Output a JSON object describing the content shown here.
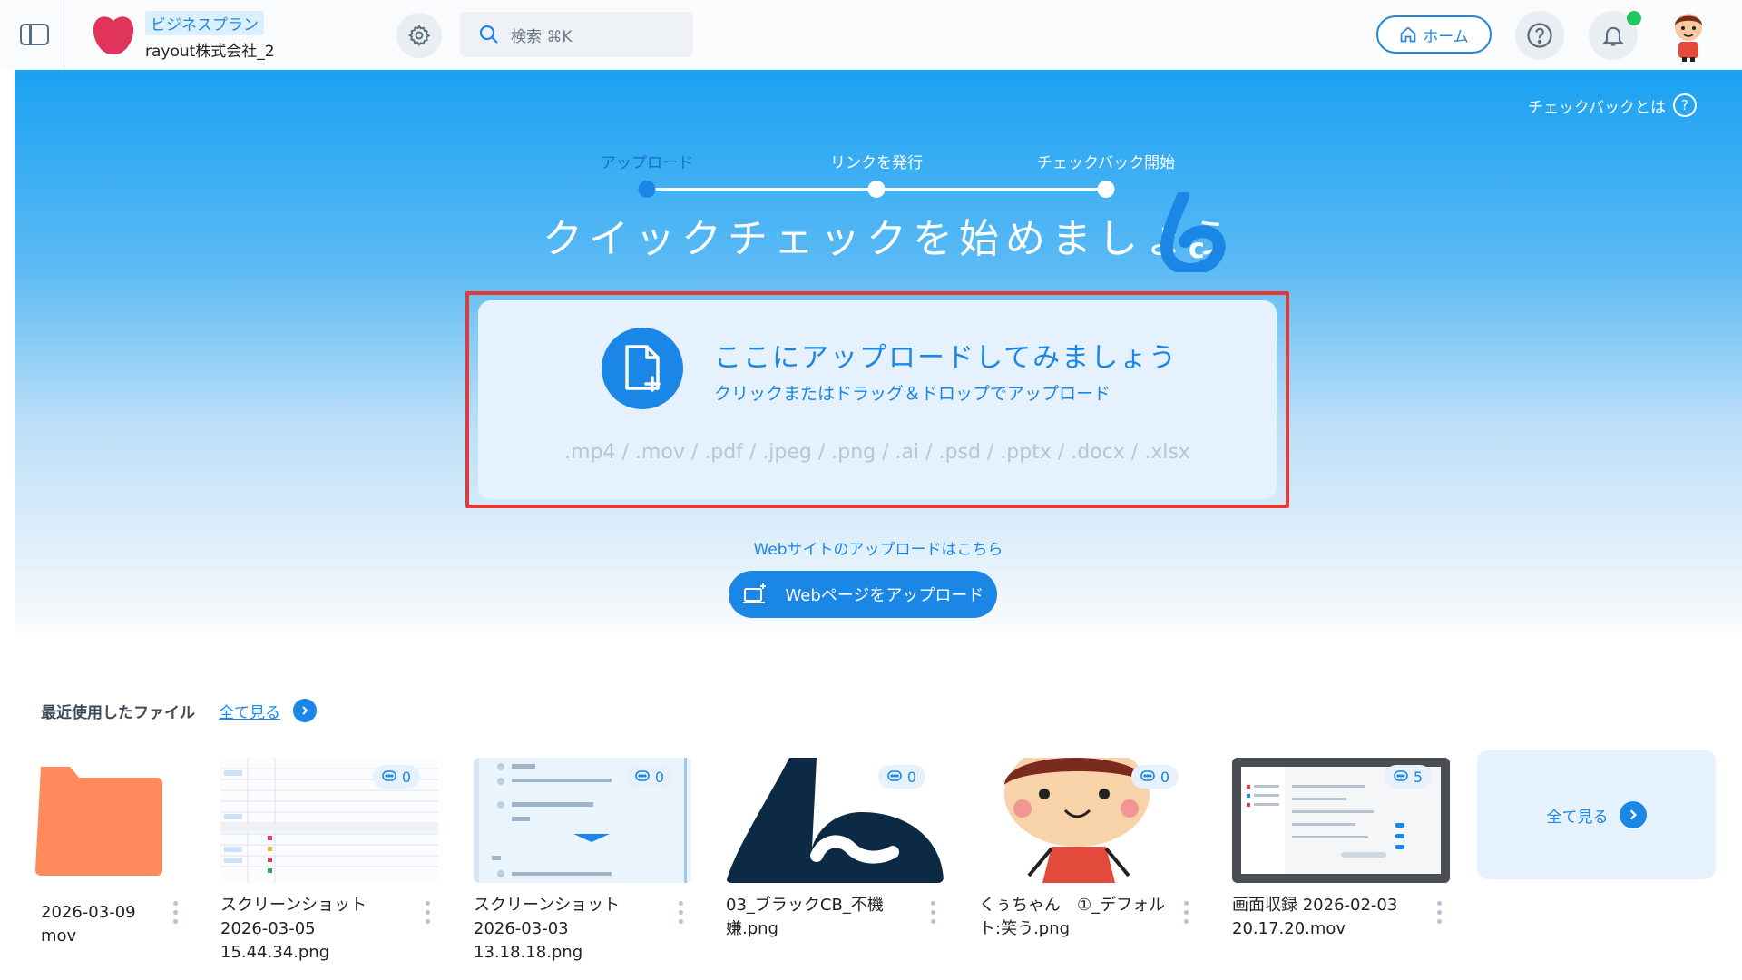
{
  "header": {
    "plan_badge": "ビジネスプラン",
    "org_name": "rayout株式会社_2",
    "search_placeholder": "検索 ⌘K",
    "home_label": "ホーム"
  },
  "hero": {
    "checkback_link": "チェックバックとは",
    "steps": [
      {
        "label": "アップロード",
        "active": true
      },
      {
        "label": "リンクを発行",
        "active": false
      },
      {
        "label": "チェックバック開始",
        "active": false
      }
    ],
    "title": "クイックチェックを始めましょう",
    "upload": {
      "title": "ここにアップロードしてみましょう",
      "subtitle": "クリックまたはドラッグ＆ドロップでアップロード",
      "formats": ".mp4 / .mov / .pdf / .jpeg / .png / .ai / .psd / .pptx / .docx / .xlsx"
    },
    "web_link": "Webサイトのアップロードはこちら",
    "web_button": "Webページをアップロード"
  },
  "recent": {
    "title": "最近使用したファイル",
    "see_all": "全て見る",
    "files": [
      {
        "name": "2026-03-09\nmov",
        "comments": null,
        "kind": "folder"
      },
      {
        "name": "スクリーンショット 2026-03-05 15.44.34.png",
        "comments": "0",
        "kind": "table"
      },
      {
        "name": "スクリーンショット 2026-03-03 13.18.18.png",
        "comments": "0",
        "kind": "list"
      },
      {
        "name": "03_ブラックCB_不機嫌.png",
        "comments": "0",
        "kind": "logo"
      },
      {
        "name": "くぅちゃん　①_デフォルト:笑う.png",
        "comments": "0",
        "kind": "character"
      },
      {
        "name": "画面収録 2026-02-03 20.17.20.mov",
        "comments": "5",
        "kind": "screen"
      }
    ],
    "see_all_card": "全て見る"
  },
  "colors": {
    "accent": "#1a86e6",
    "highlight_frame": "#e53935",
    "logo": "#e0345a",
    "notification": "#22c55e",
    "folder": "#ff8a5c"
  }
}
